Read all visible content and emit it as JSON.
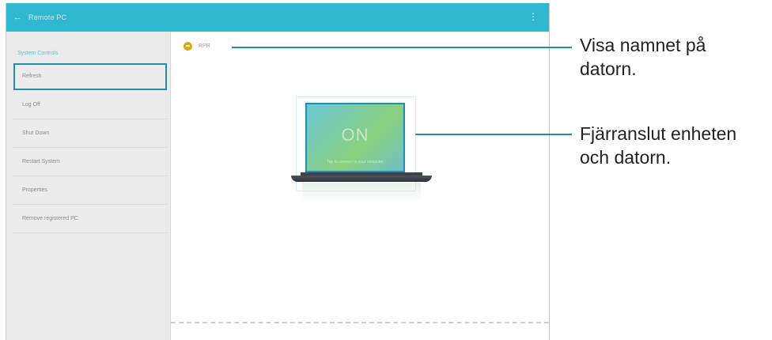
{
  "app": {
    "title": "Remote PC",
    "back_icon": "arrow-left-icon",
    "more_icon": "more-vert-icon",
    "accent_color": "#2fb8cf"
  },
  "sidebar": {
    "section_label": "System Controls",
    "items": [
      {
        "label": "Refresh",
        "selected": true
      },
      {
        "label": "Log Off"
      },
      {
        "label": "Shut Down"
      },
      {
        "label": "Restart System"
      },
      {
        "label": "Properties"
      },
      {
        "label": "Remove registered PC"
      }
    ]
  },
  "content": {
    "pc_name": "RPR",
    "screen_status": "ON",
    "screen_subtext": "Tap to connect to your computer"
  },
  "callouts": {
    "name": "Visa namnet på datorn.",
    "connect": "Fjärranslut enheten och datorn."
  }
}
